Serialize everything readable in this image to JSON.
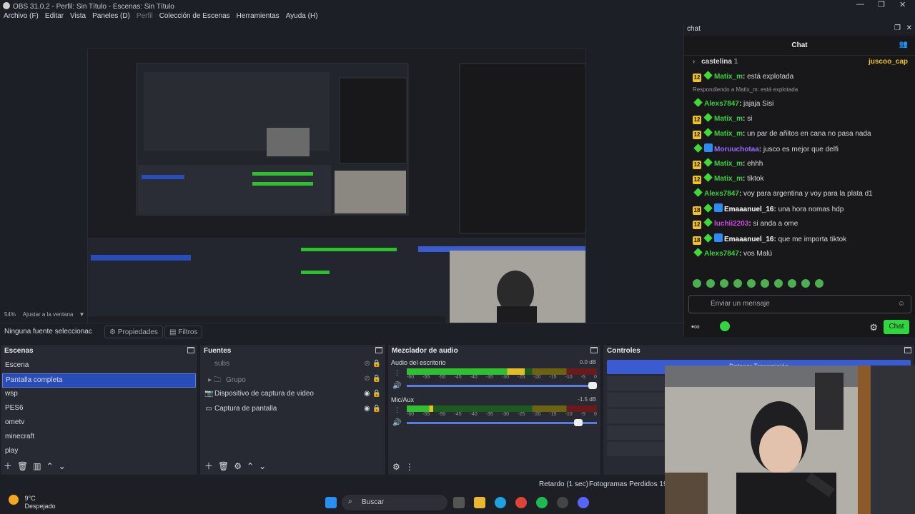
{
  "app": {
    "title": "OBS 31.0.2 - Perfil: Sin Título - Escenas: Sin Título",
    "menu": [
      "Archivo (F)",
      "Editar",
      "Vista",
      "Paneles (D)",
      "Perfil",
      "Colección de Escenas",
      "Herramientas",
      "Ayuda (H)"
    ]
  },
  "preview": {
    "zoom": "54%",
    "zoom_label": "Ajustar a la ventana"
  },
  "propbar": {
    "no_source": "Ninguna fuente seleccionac",
    "properties": "Propiedades",
    "filters": "Filtros"
  },
  "scenes": {
    "title": "Escenas",
    "items": [
      "Escena",
      "Pantalla completa",
      "wsp",
      "PES6",
      "ometv",
      "minecraft",
      "play"
    ],
    "selected": "Pantalla completa"
  },
  "sources": {
    "title": "Fuentes",
    "items": [
      {
        "name": "subs",
        "icon": "text-icon"
      },
      {
        "name": "Grupo",
        "icon": "folder-icon"
      },
      {
        "name": "Dispositivo de captura de video",
        "icon": "camera-icon"
      },
      {
        "name": "Captura de pantalla",
        "icon": "monitor-icon"
      }
    ]
  },
  "mixer": {
    "title": "Mezclador de audio",
    "channels": [
      {
        "name": "Audio del escritorio",
        "db": "0.0 dB",
        "level": 0.62,
        "volume": 1.0
      },
      {
        "name": "Mic/Aux",
        "db": "-1.5 dB",
        "level": 0.14,
        "volume": 0.92
      }
    ],
    "scale": [
      "-60",
      "-55",
      "-50",
      "-45",
      "-40",
      "-35",
      "-30",
      "-25",
      "-20",
      "-15",
      "-10",
      "-5",
      "0"
    ]
  },
  "controls": {
    "title": "Controles",
    "start_stream": "Detener Transmisión"
  },
  "status": {
    "delay": "Retardo (1 sec)",
    "dropped": "Fotogramas Perdidos 194 ("
  },
  "taskbar": {
    "temp": "9°C",
    "weather": "Despejado",
    "search": "Buscar"
  },
  "chat": {
    "window_title": "chat",
    "header": "Chat",
    "pinned_user": "castelina",
    "pinned_count": "1",
    "pinned_right": "juscoo_cap",
    "messages": [
      {
        "sub": "12",
        "user": "Matix_m",
        "text": "está explotada",
        "color": "#3ad13a"
      },
      {
        "reply": "Respondiendo a Matix_m: está explotada"
      },
      {
        "sub": "",
        "user": "Alexs7847",
        "text": "jajaja Sisi",
        "color": "#3ad13a"
      },
      {
        "sub": "12",
        "user": "Matix_m",
        "text": "si",
        "color": "#3ad13a"
      },
      {
        "sub": "12",
        "user": "Matix_m",
        "text": "un par de añitos en cana no pasa nada",
        "color": "#3ad13a"
      },
      {
        "sub": "",
        "prime": true,
        "user": "Moruuchotaa",
        "text": "jusco es mejor que delfi",
        "color": "#9b6cff"
      },
      {
        "sub": "12",
        "user": "Matix_m",
        "text": "ehhh",
        "color": "#3ad13a"
      },
      {
        "sub": "12",
        "user": "Matix_m",
        "text": "tiktok",
        "color": "#3ad13a"
      },
      {
        "sub": "",
        "user": "Alexs7847",
        "text": "voy para argentina y voy para la plata d1",
        "color": "#3ad13a"
      },
      {
        "sub": "18",
        "prime": true,
        "user": "Emaaanuel_16",
        "text": "una hora nomas hdp",
        "color": "#ffffff"
      },
      {
        "sub": "12",
        "user": "luchii2203",
        "text": "si anda a ome",
        "color": "#d04adf"
      },
      {
        "sub": "18",
        "prime": true,
        "user": "Emaaanuel_16",
        "text": "que me importa tiktok",
        "color": "#ffffff"
      },
      {
        "sub": "",
        "user": "Alexs7847",
        "text": "vos Malú",
        "color": "#3ad13a"
      }
    ],
    "input_placeholder": "Enviar un mensaje",
    "send": "Chat"
  }
}
